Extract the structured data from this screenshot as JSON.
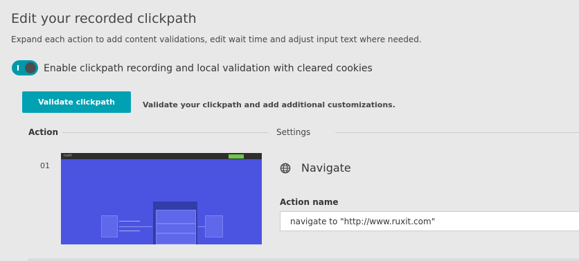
{
  "header": {
    "title": "Edit your recorded clickpath",
    "subtitle": "Expand each action to add content validations, edit wait time and adjust input text where needed."
  },
  "toggle": {
    "label": "Enable clickpath recording and local validation with cleared cookies",
    "state": "on",
    "accent_color": "#0098aa"
  },
  "validate": {
    "button_label": "Validate clickpath",
    "description": "Validate your clickpath and add additional customizations.",
    "button_color": "#00a1b2"
  },
  "columns": {
    "action": "Action",
    "settings": "Settings"
  },
  "actions": [
    {
      "number": "01",
      "thumbnail_logo": "ruxit",
      "type_icon": "globe-icon",
      "type": "Navigate",
      "name_label": "Action name",
      "name_value": "navigate to \"http://www.ruxit.com\""
    }
  ]
}
